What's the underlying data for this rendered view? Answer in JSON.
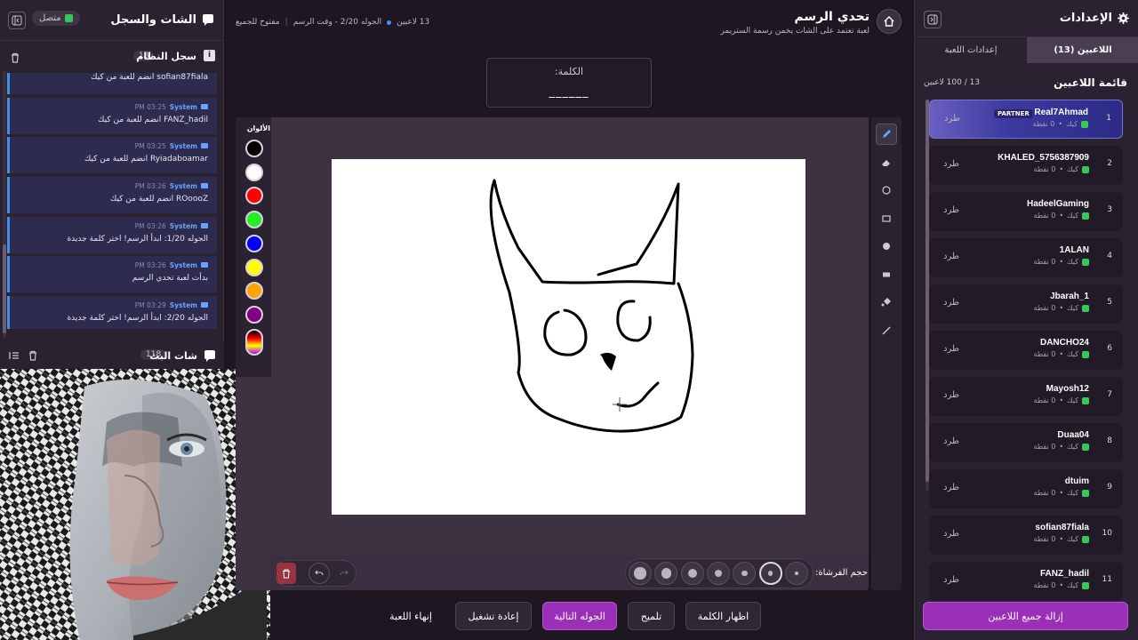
{
  "left_panel": {
    "title": "الشات والسجل",
    "status": "متصل",
    "system_log": {
      "title": "سجل النظام",
      "count": "18"
    },
    "messages": [
      {
        "sender": "",
        "time": "",
        "text": "sofian87fiala انضم للعبة من كيك"
      },
      {
        "sender": "System",
        "time": "03:25 PM",
        "text": "FANZ_hadil انضم للعبة من كيك"
      },
      {
        "sender": "System",
        "time": "03:25 PM",
        "text": "Ryiadaboamar انضم للعبة من كيك"
      },
      {
        "sender": "System",
        "time": "03:26 PM",
        "text": "ROoooZ انضم للعبة من كيك"
      },
      {
        "sender": "System",
        "time": "03:26 PM",
        "text": "الجوله 1/20: ابدأ الرسم! اختر كلمة جديدة"
      },
      {
        "sender": "System",
        "time": "03:26 PM",
        "text": "بدأت لعبة تحدي الرسم"
      },
      {
        "sender": "System",
        "time": "03:29 PM",
        "text": "الجوله 2/20: ابدأ الرسم! اختر كلمة جديدة"
      }
    ],
    "stream_chat": {
      "title": "شات البث",
      "count": "118"
    }
  },
  "header": {
    "title": "تحدي الرسم",
    "subtitle": "لعبة تعتمد على الشات يخمن رسمة الستريمر",
    "players": "13 لاعبين",
    "round": "الجوله 2/20 - وقت الرسم",
    "open": "مفتوح للجميع"
  },
  "word": {
    "label": "الكلمة:",
    "blanks": "______"
  },
  "colors": {
    "label": "الألوان",
    "swatches": [
      "#000000",
      "#ffffff",
      "#ff0000",
      "#22ee22",
      "#0000ff",
      "#ffff00",
      "#ffa500",
      "#800080"
    ]
  },
  "brush": {
    "label": "حجم الفرشاة:",
    "sizes": [
      1,
      2,
      3,
      4,
      5,
      6,
      7
    ],
    "selected": 2
  },
  "actions": {
    "reveal": "اظهار الكلمة",
    "hint": "تلميح",
    "next_round": "الجوله التالية",
    "restart": "إعادة تشغيل",
    "end_game": "إنهاء اللعبة"
  },
  "right_panel": {
    "title": "الإعدادات",
    "tabs": [
      "اللاعبين (13)",
      "إعدادات اللعبة"
    ],
    "list_title": "قائمة اللاعبين",
    "list_count": "13 / 100 لاعبين",
    "kick_label": "طرد",
    "platform": "كيك",
    "points": "0 نقطة",
    "partner": "PARTNER",
    "players": [
      {
        "rank": "1",
        "name": "Real7Ahmad"
      },
      {
        "rank": "2",
        "name": "KHALED_5756387909"
      },
      {
        "rank": "3",
        "name": "HadeelGaming"
      },
      {
        "rank": "4",
        "name": "1ALAN"
      },
      {
        "rank": "5",
        "name": "Jbarah_1"
      },
      {
        "rank": "6",
        "name": "DANCHO24"
      },
      {
        "rank": "7",
        "name": "Mayosh12"
      },
      {
        "rank": "8",
        "name": "Duaa04"
      },
      {
        "rank": "9",
        "name": "dtuim"
      },
      {
        "rank": "10",
        "name": "sofian87fiala"
      },
      {
        "rank": "11",
        "name": "FANZ_hadil"
      }
    ],
    "remove_all": "إزالة جميع اللاعبين"
  }
}
